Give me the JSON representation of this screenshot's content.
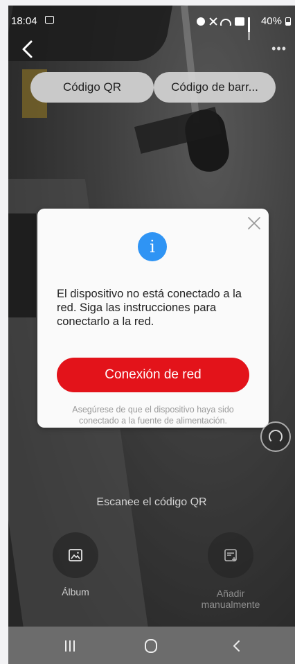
{
  "status_bar": {
    "time": "18:04",
    "battery": "40%"
  },
  "tabs": [
    {
      "label": "Código QR",
      "selected": true
    },
    {
      "label": "Código de barr..."
    }
  ],
  "dialog": {
    "message": "El dispositivo no está conectado a la red. Siga las instrucciones para conectarlo a la red.",
    "button_label": "Conexión de red",
    "note": "Asegúrese de que el dispositivo haya sido conectado a la fuente de alimentación.",
    "icon": "info-icon",
    "accent_color": "#e3131a",
    "info_color": "#2f94f4"
  },
  "scanner": {
    "hint": "Escanee el código QR"
  },
  "bottom_actions": {
    "album_label": "Álbum",
    "manual_label": "Añadir manualmente"
  },
  "icons": {
    "back": "back-arrow-icon",
    "more": "more-icon",
    "album": "image-icon",
    "manual": "add-card-icon",
    "support": "headset-icon"
  }
}
